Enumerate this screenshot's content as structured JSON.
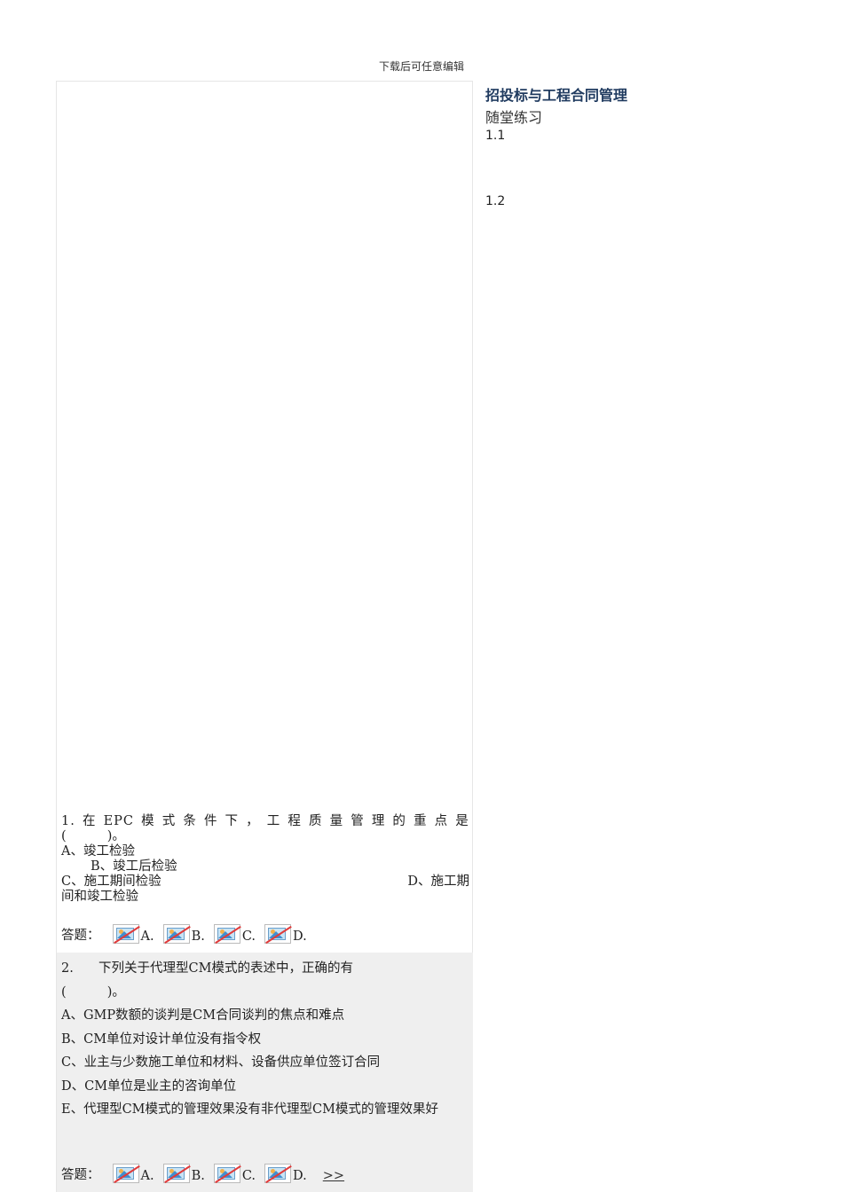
{
  "header": {
    "note": "下载后可任意编辑"
  },
  "sidebar": {
    "title": "招投标与工程合同管理",
    "subtitle": "随堂练习",
    "items": [
      "1.1",
      "1.2"
    ]
  },
  "q1": {
    "stem_parts": [
      "1.",
      "在",
      "EPC",
      "模",
      "式",
      "条",
      "件",
      "下",
      "，",
      "工",
      "程",
      "质",
      "量",
      "管",
      "理",
      "的",
      "重",
      "点",
      "是"
    ],
    "blank": "(          )。",
    "option_a": "A、竣工检验",
    "option_b": "B、竣工后检验",
    "option_c": "C、施工期间检验",
    "option_d_start": "D、施工期",
    "option_d_end": "间和竣工检验",
    "answer_label": "答题：",
    "choices": [
      "A.",
      "B.",
      "C.",
      "D."
    ]
  },
  "q2": {
    "num": "2.",
    "stem": "下列关于代理型CM模式的表述中，正确的有",
    "blank": "(          )。",
    "options": [
      "A、GMP数额的谈判是CM合同谈判的焦点和难点",
      "B、CM单位对设计单位没有指令权",
      "C、业主与少数施工单位和材料、设备供应单位签订合同",
      "D、CM单位是业主的咨询单位",
      "E、代理型CM模式的管理效果没有非代理型CM模式的管理效果好"
    ],
    "answer_label": "答题：",
    "choices": [
      "A.",
      "B.",
      "C.",
      "D."
    ],
    "next": ">>"
  }
}
